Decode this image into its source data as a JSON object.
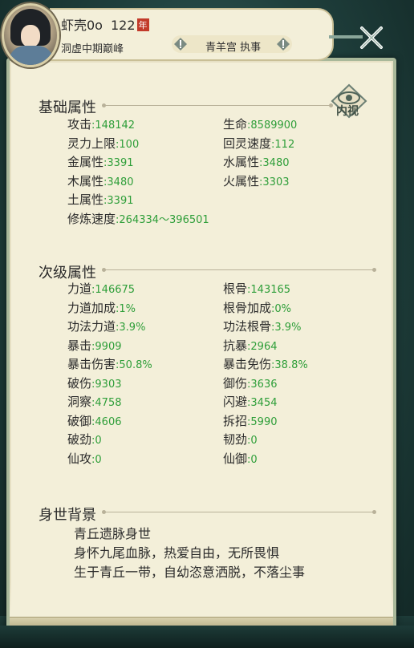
{
  "header": {
    "player_name": "虾壳0o",
    "level": "122",
    "year_badge": "年",
    "realm": "洞虚中期巅峰",
    "sect": "青羊宫 执事"
  },
  "inner_view_label": "内视",
  "basic": {
    "title": "基础属性",
    "stats": [
      {
        "label": "攻击",
        "value": ":148142"
      },
      {
        "label": "生命",
        "value": ":8589900"
      },
      {
        "label": "灵力上限",
        "value": ":100"
      },
      {
        "label": "回灵速度",
        "value": ":112"
      },
      {
        "label": "金属性",
        "value": ":3391"
      },
      {
        "label": "水属性",
        "value": ":3480"
      },
      {
        "label": "木属性",
        "value": ":3480"
      },
      {
        "label": "火属性",
        "value": ":3303"
      },
      {
        "label": "土属性",
        "value": ":3391"
      },
      {
        "label": "修炼速度",
        "value": ":264334～396501"
      }
    ]
  },
  "secondary": {
    "title": "次级属性",
    "stats": [
      {
        "label": "力道",
        "value": ":146675"
      },
      {
        "label": "根骨",
        "value": ":143165"
      },
      {
        "label": "力道加成",
        "value": ":1%"
      },
      {
        "label": "根骨加成",
        "value": ":0%"
      },
      {
        "label": "功法力道",
        "value": ":3.9%"
      },
      {
        "label": "功法根骨",
        "value": ":3.9%"
      },
      {
        "label": "暴击",
        "value": ":9909"
      },
      {
        "label": "抗暴",
        "value": ":2964"
      },
      {
        "label": "暴击伤害",
        "value": ":50.8%"
      },
      {
        "label": "暴击免伤",
        "value": ":38.8%"
      },
      {
        "label": "破伤",
        "value": ":9303"
      },
      {
        "label": "御伤",
        "value": ":3636"
      },
      {
        "label": "洞察",
        "value": ":4758"
      },
      {
        "label": "闪避",
        "value": ":3454"
      },
      {
        "label": "破御",
        "value": ":4606"
      },
      {
        "label": "拆招",
        "value": ":5990"
      },
      {
        "label": "破劲",
        "value": ":0"
      },
      {
        "label": "韧劲",
        "value": ":0"
      },
      {
        "label": "仙攻",
        "value": ":0"
      },
      {
        "label": "仙御",
        "value": ":0"
      }
    ]
  },
  "background": {
    "title": "身世背景",
    "lines": [
      "青丘遗脉身世",
      "身怀九尾血脉，热爱自由，无所畏惧",
      "生于青丘一带，自幼恣意洒脱，不落尘事"
    ]
  },
  "colors": {
    "value_green": "#2e9e39",
    "badge_red": "#c23a2a"
  }
}
